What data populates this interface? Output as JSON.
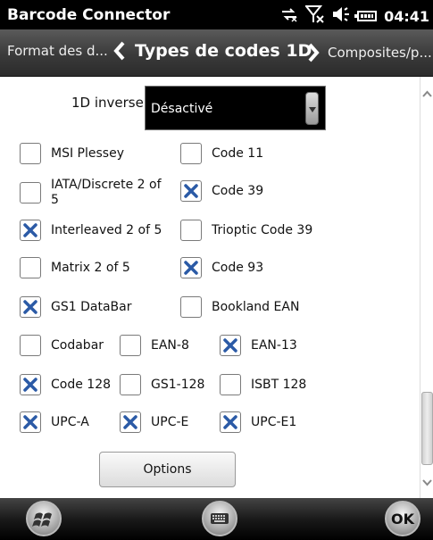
{
  "status_bar": {
    "app_title": "Barcode Connector",
    "time": "04:41",
    "icons": [
      "connectivity-icon",
      "signal-off-icon",
      "volume-icon",
      "battery-icon"
    ]
  },
  "nav": {
    "prev_label": "Format des d...",
    "current_label": "Types de codes 1D",
    "next_label": "Composites/p..."
  },
  "inverse": {
    "label": "1D inverse",
    "value": "Désactivé"
  },
  "checkboxes": {
    "msi_plessey": {
      "label": "MSI Plessey",
      "checked": false
    },
    "code_11": {
      "label": "Code 11",
      "checked": false
    },
    "iata_line1": "IATA/Discrete 2 of",
    "iata_line2": "5",
    "iata_checked": false,
    "code_39": {
      "label": "Code 39",
      "checked": true
    },
    "interleaved": {
      "label": "Interleaved 2 of 5",
      "checked": true
    },
    "trioptic": {
      "label": "Trioptic Code 39",
      "checked": false
    },
    "matrix": {
      "label": "Matrix 2 of 5",
      "checked": false
    },
    "code_93": {
      "label": "Code 93",
      "checked": true
    },
    "gs1_databar": {
      "label": "GS1 DataBar",
      "checked": true
    },
    "bookland": {
      "label": "Bookland EAN",
      "checked": false
    },
    "codabar": {
      "label": "Codabar",
      "checked": false
    },
    "ean8": {
      "label": "EAN-8",
      "checked": false
    },
    "ean13": {
      "label": "EAN-13",
      "checked": true
    },
    "code128": {
      "label": "Code 128",
      "checked": true
    },
    "gs1_128": {
      "label": "GS1-128",
      "checked": false
    },
    "isbt128": {
      "label": "ISBT 128",
      "checked": false
    },
    "upca": {
      "label": "UPC-A",
      "checked": true
    },
    "upce": {
      "label": "UPC-E",
      "checked": true
    },
    "upce1": {
      "label": "UPC-E1",
      "checked": true
    }
  },
  "options_button": "Options",
  "bottom_bar": {
    "ok_label": "OK"
  },
  "colors": {
    "check_blue": "#2b5aa6",
    "nav_bg": "#3a3a3a"
  }
}
